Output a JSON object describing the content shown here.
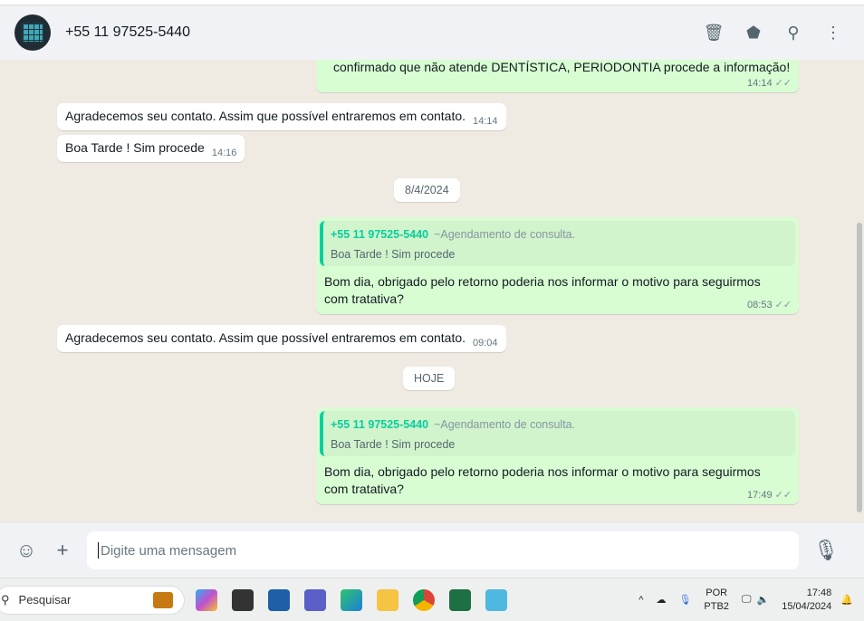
{
  "header": {
    "contact": "+55 11 97525-5440"
  },
  "messages": [
    {
      "dir": "out",
      "text": "confirmado que não atende DENTÍSTICA, PERIODONTIA procede a informação!",
      "time": "14:14"
    },
    {
      "dir": "in",
      "text": "Agradecemos seu contato. Assim que possível entraremos em contato.",
      "time": "14:14"
    },
    {
      "dir": "in",
      "text": "Boa Tarde ! Sim procede",
      "time": "14:16"
    },
    {
      "date": "8/4/2024"
    },
    {
      "dir": "out",
      "quote": {
        "name": "+55 11 97525-5440",
        "sub": "~Agendamento de consulta.",
        "text": "Boa Tarde ! Sim procede"
      },
      "text": "Bom dia, obrigado pelo retorno poderia nos informar o motivo para seguirmos com tratativa?",
      "time": "08:53"
    },
    {
      "dir": "in",
      "text": "Agradecemos seu contato. Assim que possível entraremos em contato.",
      "time": "09:04"
    },
    {
      "date": "HOJE"
    },
    {
      "dir": "out",
      "quote": {
        "name": "+55 11 97525-5440",
        "sub": "~Agendamento de consulta.",
        "text": "Boa Tarde ! Sim procede"
      },
      "text": "Bom dia, obrigado pelo retorno poderia nos informar o motivo para seguirmos com tratativa?",
      "time": "17:49"
    }
  ],
  "composer": {
    "placeholder": "Digite uma mensagem"
  },
  "taskbar": {
    "search": "Pesquisar",
    "lang1": "POR",
    "lang2": "PTB2",
    "time": "17:48",
    "date": "15/04/2024"
  }
}
